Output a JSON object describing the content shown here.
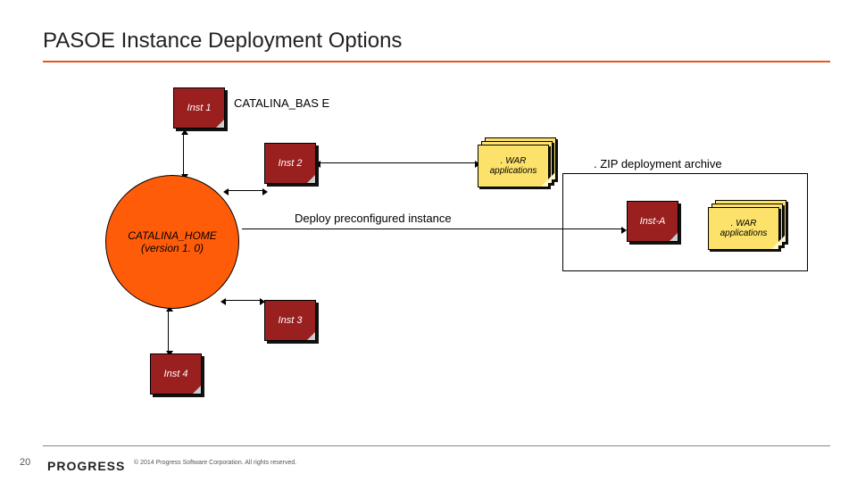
{
  "title": "PASOE Instance Deployment Options",
  "catalina_base_label": "CATALINA_BAS E",
  "zip_label": ". ZIP deployment archive",
  "deploy_label": "Deploy preconfigured instance",
  "circle": {
    "line1": "CATALINA_HOME",
    "line2": "(version 1. 0)"
  },
  "notes": {
    "inst1": "Inst 1",
    "inst2": "Inst 2",
    "inst3": "Inst 3",
    "inst4": "Inst 4",
    "instA": "Inst-A"
  },
  "war_label": ". WAR applications",
  "footer": {
    "page": "20",
    "brand": "PROGRESS",
    "copyright": "© 2014 Progress Software Corporation. All rights reserved."
  }
}
